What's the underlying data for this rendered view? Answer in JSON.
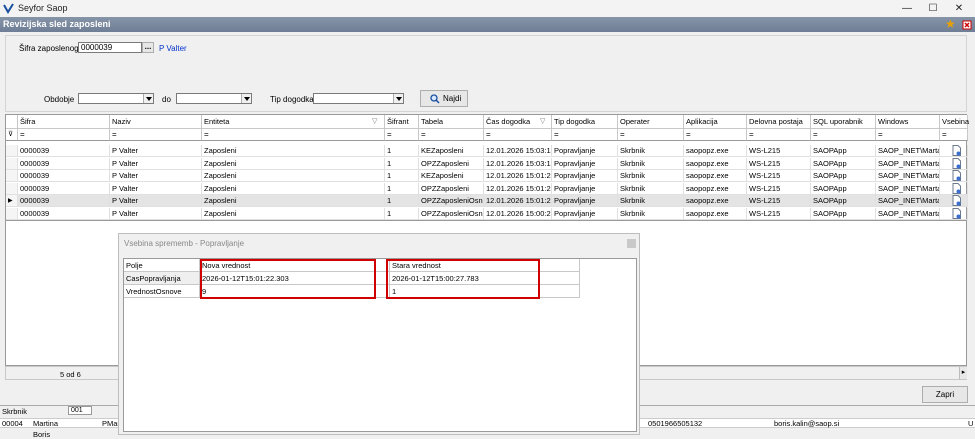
{
  "app": {
    "title": "Seyfor Saop",
    "form_title": "Revizijska sled zaposleni"
  },
  "filters": {
    "sifra_label": "Šifra zaposlenog",
    "sifra_value": "0000039",
    "lookup_btn": "...",
    "employee_name": "P Valter",
    "obdobje_label": "Obdobje",
    "do_label": "do",
    "tip_label": "Tip dogodka",
    "search_btn": "Najdi"
  },
  "grid": {
    "columns": [
      "Šifra",
      "Naziv",
      "Entiteta",
      "Šifrant",
      "Tabela",
      "Čas dogodka",
      "Tip dogodka",
      "Operater",
      "Aplikacija",
      "Delovna postaja",
      "SQL uporabnik",
      "Windows uporabnik",
      "Vsebina"
    ],
    "filter_symbol": "=",
    "rows": [
      [
        "0000039",
        "P Valter",
        "Zaposleni",
        "1",
        "KEZaposleni",
        "12.01.2026 15:03:15",
        "Popravljanje",
        "Skrbnik",
        "saopopz.exe",
        "WS-L215",
        "SAOPApp",
        "SAOP_INET\\Marta."
      ],
      [
        "0000039",
        "P Valter",
        "Zaposleni",
        "1",
        "OPZZaposleni",
        "12.01.2026 15:03:15",
        "Popravljanje",
        "Skrbnik",
        "saopopz.exe",
        "WS-L215",
        "SAOPApp",
        "SAOP_INET\\Marta."
      ],
      [
        "0000039",
        "P Valter",
        "Zaposleni",
        "1",
        "KEZaposleni",
        "12.01.2026 15:01:23",
        "Popravljanje",
        "Skrbnik",
        "saopopz.exe",
        "WS-L215",
        "SAOPApp",
        "SAOP_INET\\Marta."
      ],
      [
        "0000039",
        "P Valter",
        "Zaposleni",
        "1",
        "OPZZaposleni",
        "12.01.2026 15:01:23",
        "Popravljanje",
        "Skrbnik",
        "saopopz.exe",
        "WS-L215",
        "SAOPApp",
        "SAOP_INET\\Marta."
      ],
      [
        "0000039",
        "P Valter",
        "Zaposleni",
        "1",
        "OPZZaposleniOsno",
        "12.01.2026 15:01:22",
        "Popravljanje",
        "Skrbnik",
        "saopopz.exe",
        "WS-L215",
        "SAOPApp",
        "SAOP_INET\\Marta."
      ],
      [
        "0000039",
        "P Valter",
        "Zaposleni",
        "1",
        "OPZZaposleniOsno",
        "12.01.2026 15:00:27",
        "Popravljanje",
        "Skrbnik",
        "saopopz.exe",
        "WS-L215",
        "SAOPApp",
        "SAOP_INET\\Marta."
      ]
    ],
    "record_count": "5 od 6"
  },
  "close_btn": "Zapri",
  "popup": {
    "title": "Vsebina sprememb - Popravljanje",
    "headers": [
      "Polje",
      "Nova vrednost",
      "Stara vrednost"
    ],
    "rows": [
      [
        "CasPopravljanja",
        "2026-01-12T15:01:22.303",
        "2026-01-12T15:00:27.783"
      ],
      [
        "VrednostOsnove",
        "9",
        "1"
      ]
    ]
  },
  "background": {
    "skrbnik": "Skrbnik",
    "code": "001",
    "row_code": "00004",
    "row_name": "Martina",
    "row_pm": "PMar",
    "row_b": "Boris",
    "row_num": "0501966505132",
    "row_email": "boris.kalin@saop.si",
    "row_u": "U"
  }
}
